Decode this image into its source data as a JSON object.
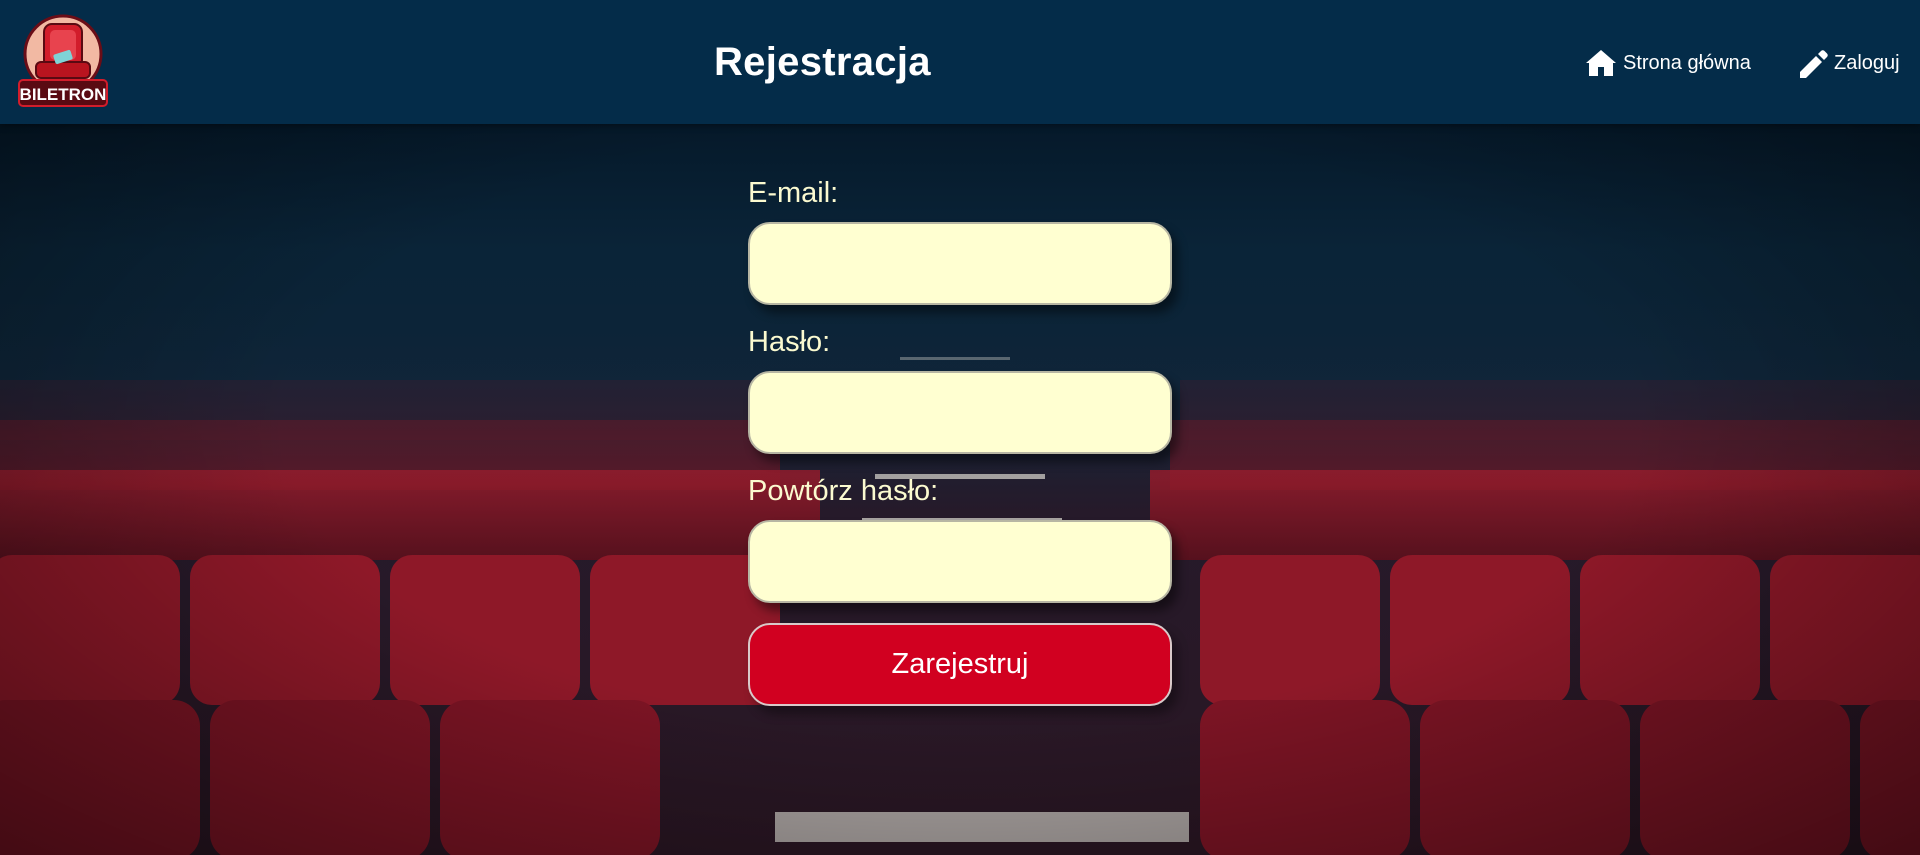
{
  "logo": {
    "text": "BILETRON"
  },
  "header": {
    "title": "Rejestracja",
    "nav": {
      "home_label": "Strona główna",
      "login_label": "Zaloguj"
    }
  },
  "form": {
    "email_label": "E-mail:",
    "email_value": "",
    "password_label": "Hasło:",
    "password_value": "",
    "repeat_password_label": "Powtórz hasło:",
    "repeat_password_value": "",
    "submit_label": "Zarejestruj"
  },
  "colors": {
    "header_bg": "#042c49",
    "label_text": "#fbfad0",
    "input_bg": "#ffffd1",
    "button_bg": "#d10020",
    "seat_red": "#8b1626"
  },
  "icons": {
    "home": "home-icon",
    "login": "pencil-icon"
  }
}
